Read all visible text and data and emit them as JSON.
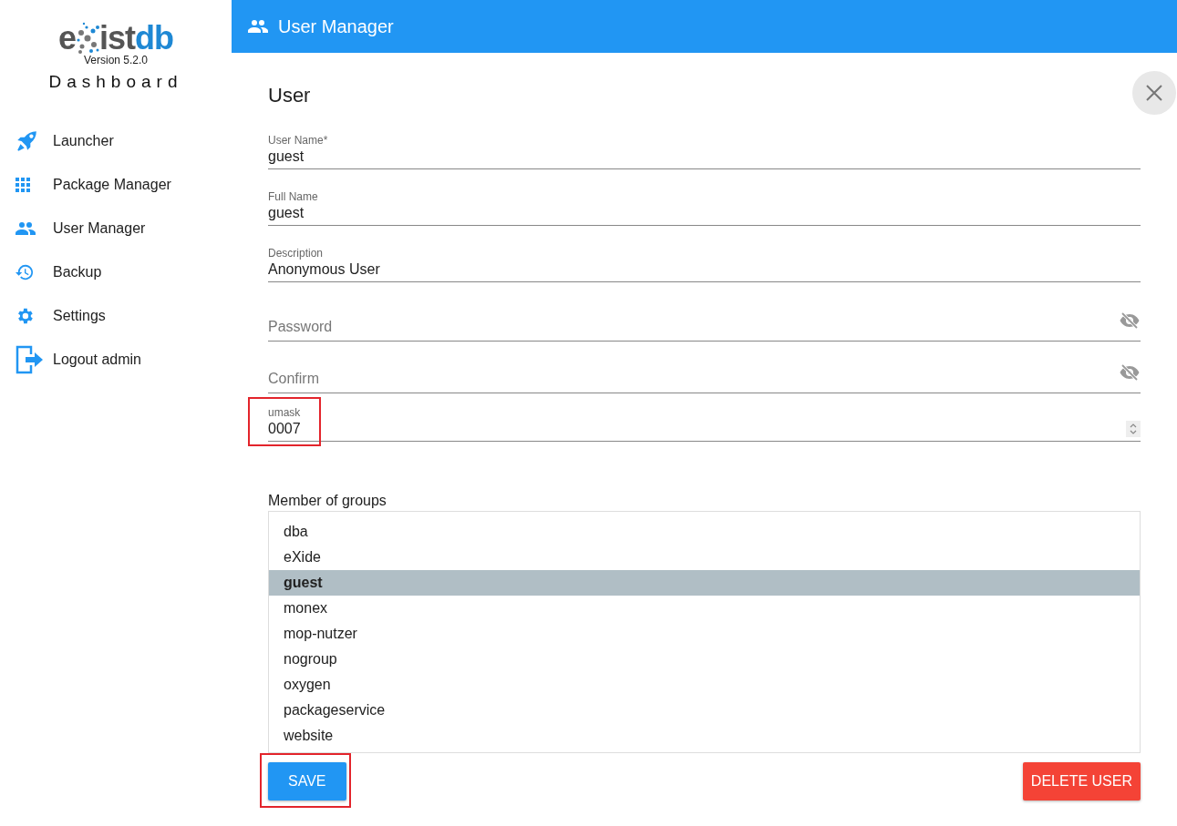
{
  "logo": {
    "prefix": "e",
    "middle": "ist",
    "suffix": "db",
    "version": "Version 5.2.0",
    "subtitle": "Dashboard"
  },
  "sidebar": {
    "items": [
      {
        "label": "Launcher",
        "kind": "rocket"
      },
      {
        "label": "Package Manager",
        "kind": "grid"
      },
      {
        "label": "User Manager",
        "kind": "people"
      },
      {
        "label": "Backup",
        "kind": "history"
      },
      {
        "label": "Settings",
        "kind": "gear"
      },
      {
        "label": "Logout admin",
        "kind": "logout"
      }
    ]
  },
  "header": {
    "title": "User Manager"
  },
  "form": {
    "title": "User",
    "fields": [
      {
        "kind": "text",
        "label": "User Name*",
        "value": "guest",
        "highlighted": false
      },
      {
        "kind": "text",
        "label": "Full Name",
        "value": "guest",
        "highlighted": false
      },
      {
        "kind": "text",
        "label": "Description",
        "value": "Anonymous User",
        "highlighted": false
      },
      {
        "kind": "password",
        "placeholder": "Password",
        "highlighted": false
      },
      {
        "kind": "password",
        "placeholder": "Confirm",
        "highlighted": false
      },
      {
        "kind": "number",
        "label": "umask",
        "value": "0007",
        "highlighted": true
      }
    ],
    "groups_label": "Member of groups",
    "groups": [
      {
        "name": "dba",
        "selected": false
      },
      {
        "name": "eXide",
        "selected": false
      },
      {
        "name": "guest",
        "selected": true
      },
      {
        "name": "monex",
        "selected": false
      },
      {
        "name": "mop-nutzer",
        "selected": false
      },
      {
        "name": "nogroup",
        "selected": false
      },
      {
        "name": "oxygen",
        "selected": false
      },
      {
        "name": "packageservice",
        "selected": false
      },
      {
        "name": "website",
        "selected": false
      }
    ],
    "buttons": [
      {
        "label": "SAVE",
        "kind": "primary",
        "highlighted": true
      },
      {
        "label": "DELETE USER",
        "kind": "danger",
        "highlighted": false
      }
    ]
  }
}
